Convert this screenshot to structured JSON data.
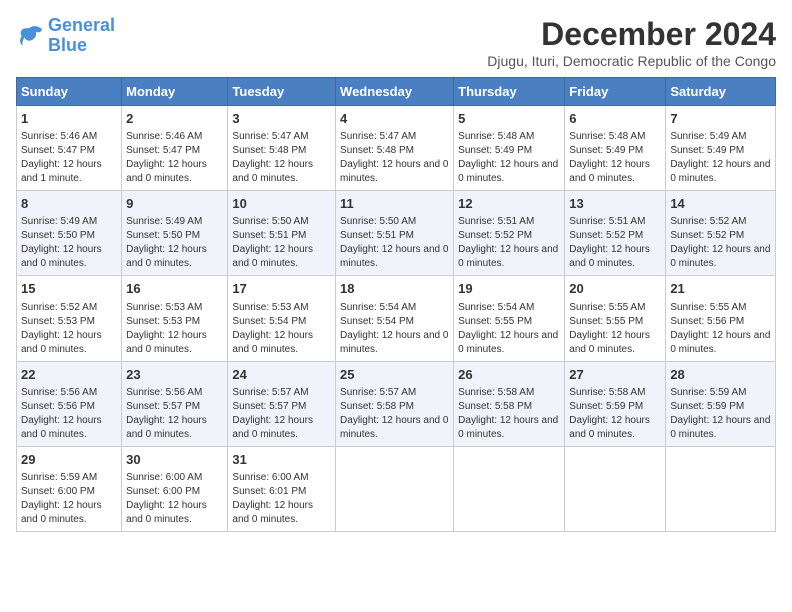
{
  "logo": {
    "line1": "General",
    "line2": "Blue"
  },
  "title": "December 2024",
  "location": "Djugu, Ituri, Democratic Republic of the Congo",
  "days_of_week": [
    "Sunday",
    "Monday",
    "Tuesday",
    "Wednesday",
    "Thursday",
    "Friday",
    "Saturday"
  ],
  "weeks": [
    [
      {
        "day": "1",
        "sunrise": "5:46 AM",
        "sunset": "5:47 PM",
        "daylight": "12 hours and 1 minute."
      },
      {
        "day": "2",
        "sunrise": "5:46 AM",
        "sunset": "5:47 PM",
        "daylight": "12 hours and 0 minutes."
      },
      {
        "day": "3",
        "sunrise": "5:47 AM",
        "sunset": "5:48 PM",
        "daylight": "12 hours and 0 minutes."
      },
      {
        "day": "4",
        "sunrise": "5:47 AM",
        "sunset": "5:48 PM",
        "daylight": "12 hours and 0 minutes."
      },
      {
        "day": "5",
        "sunrise": "5:48 AM",
        "sunset": "5:49 PM",
        "daylight": "12 hours and 0 minutes."
      },
      {
        "day": "6",
        "sunrise": "5:48 AM",
        "sunset": "5:49 PM",
        "daylight": "12 hours and 0 minutes."
      },
      {
        "day": "7",
        "sunrise": "5:49 AM",
        "sunset": "5:49 PM",
        "daylight": "12 hours and 0 minutes."
      }
    ],
    [
      {
        "day": "8",
        "sunrise": "5:49 AM",
        "sunset": "5:50 PM",
        "daylight": "12 hours and 0 minutes."
      },
      {
        "day": "9",
        "sunrise": "5:49 AM",
        "sunset": "5:50 PM",
        "daylight": "12 hours and 0 minutes."
      },
      {
        "day": "10",
        "sunrise": "5:50 AM",
        "sunset": "5:51 PM",
        "daylight": "12 hours and 0 minutes."
      },
      {
        "day": "11",
        "sunrise": "5:50 AM",
        "sunset": "5:51 PM",
        "daylight": "12 hours and 0 minutes."
      },
      {
        "day": "12",
        "sunrise": "5:51 AM",
        "sunset": "5:52 PM",
        "daylight": "12 hours and 0 minutes."
      },
      {
        "day": "13",
        "sunrise": "5:51 AM",
        "sunset": "5:52 PM",
        "daylight": "12 hours and 0 minutes."
      },
      {
        "day": "14",
        "sunrise": "5:52 AM",
        "sunset": "5:52 PM",
        "daylight": "12 hours and 0 minutes."
      }
    ],
    [
      {
        "day": "15",
        "sunrise": "5:52 AM",
        "sunset": "5:53 PM",
        "daylight": "12 hours and 0 minutes."
      },
      {
        "day": "16",
        "sunrise": "5:53 AM",
        "sunset": "5:53 PM",
        "daylight": "12 hours and 0 minutes."
      },
      {
        "day": "17",
        "sunrise": "5:53 AM",
        "sunset": "5:54 PM",
        "daylight": "12 hours and 0 minutes."
      },
      {
        "day": "18",
        "sunrise": "5:54 AM",
        "sunset": "5:54 PM",
        "daylight": "12 hours and 0 minutes."
      },
      {
        "day": "19",
        "sunrise": "5:54 AM",
        "sunset": "5:55 PM",
        "daylight": "12 hours and 0 minutes."
      },
      {
        "day": "20",
        "sunrise": "5:55 AM",
        "sunset": "5:55 PM",
        "daylight": "12 hours and 0 minutes."
      },
      {
        "day": "21",
        "sunrise": "5:55 AM",
        "sunset": "5:56 PM",
        "daylight": "12 hours and 0 minutes."
      }
    ],
    [
      {
        "day": "22",
        "sunrise": "5:56 AM",
        "sunset": "5:56 PM",
        "daylight": "12 hours and 0 minutes."
      },
      {
        "day": "23",
        "sunrise": "5:56 AM",
        "sunset": "5:57 PM",
        "daylight": "12 hours and 0 minutes."
      },
      {
        "day": "24",
        "sunrise": "5:57 AM",
        "sunset": "5:57 PM",
        "daylight": "12 hours and 0 minutes."
      },
      {
        "day": "25",
        "sunrise": "5:57 AM",
        "sunset": "5:58 PM",
        "daylight": "12 hours and 0 minutes."
      },
      {
        "day": "26",
        "sunrise": "5:58 AM",
        "sunset": "5:58 PM",
        "daylight": "12 hours and 0 minutes."
      },
      {
        "day": "27",
        "sunrise": "5:58 AM",
        "sunset": "5:59 PM",
        "daylight": "12 hours and 0 minutes."
      },
      {
        "day": "28",
        "sunrise": "5:59 AM",
        "sunset": "5:59 PM",
        "daylight": "12 hours and 0 minutes."
      }
    ],
    [
      {
        "day": "29",
        "sunrise": "5:59 AM",
        "sunset": "6:00 PM",
        "daylight": "12 hours and 0 minutes."
      },
      {
        "day": "30",
        "sunrise": "6:00 AM",
        "sunset": "6:00 PM",
        "daylight": "12 hours and 0 minutes."
      },
      {
        "day": "31",
        "sunrise": "6:00 AM",
        "sunset": "6:01 PM",
        "daylight": "12 hours and 0 minutes."
      },
      null,
      null,
      null,
      null
    ]
  ]
}
